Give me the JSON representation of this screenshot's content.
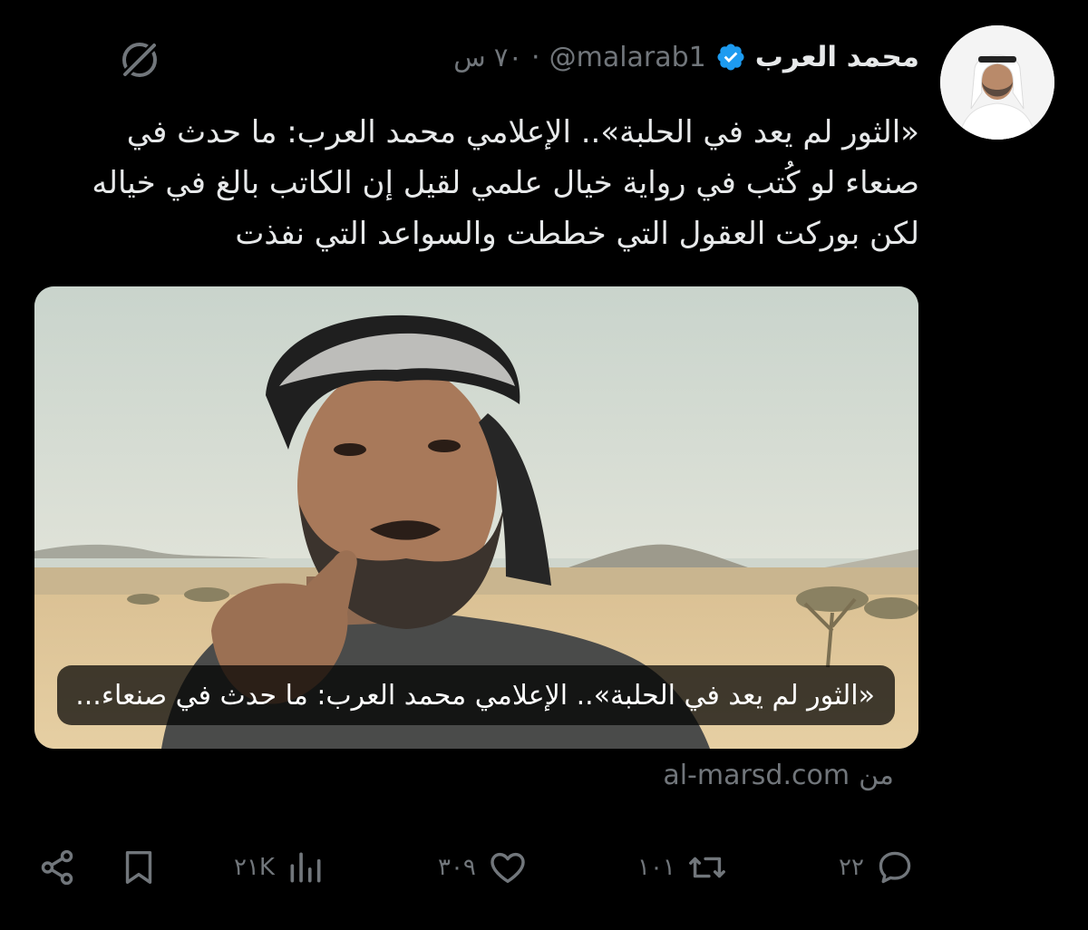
{
  "tweet": {
    "display_name": "محمد العرب",
    "handle": "@malarab1",
    "separator": "·",
    "time": "٧٠ س",
    "verified_color": "#1d9bf0",
    "text_lines": [
      "«الثور لم يعد في الحلبة».. الإعلامي محمد العرب: ما حدث في",
      "صنعاء لو كُتب في رواية خيال علمي لقيل إن الكاتب بالغ في خياله",
      "لكن بوركت العقول التي خططت والسواعد التي نفذت"
    ],
    "card": {
      "caption": "«الثور لم يعد في الحلبة».. الإعلامي محمد العرب: ما حدث في صنعاء..."
    },
    "source": {
      "from_label": "من",
      "domain": "al-marsd.com"
    },
    "actions": {
      "replies": "٢٢",
      "retweets": "١٠١",
      "likes": "٣٠٩",
      "views": "٢١K"
    }
  },
  "icons": {
    "top_right_menu": "grok-icon",
    "reply": "reply-icon",
    "retweet": "retweet-icon",
    "like": "heart-icon",
    "views": "views-icon",
    "bookmark": "bookmark-icon",
    "share": "share-icon"
  },
  "colors": {
    "background": "#000000",
    "text": "#e7e9ea",
    "muted": "#71767b",
    "accent": "#1d9bf0"
  }
}
